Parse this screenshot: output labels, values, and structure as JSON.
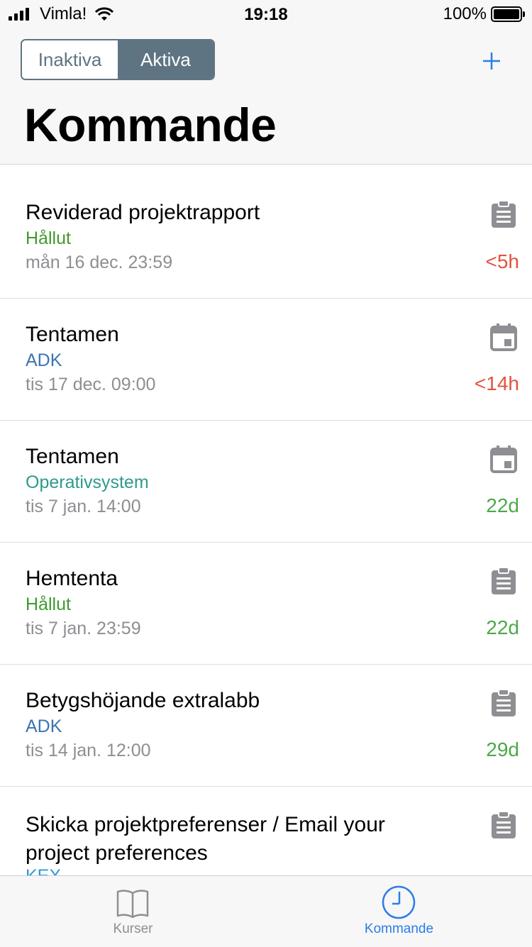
{
  "status_bar": {
    "carrier": "Vimla!",
    "time": "19:18",
    "battery": "100%"
  },
  "header": {
    "segments": [
      "Inaktiva",
      "Aktiva"
    ],
    "selected_segment": "Aktiva",
    "add_label": "+",
    "title": "Kommande"
  },
  "items": [
    {
      "title": "Reviderad projektrapport",
      "course": "Hållut",
      "course_color": "#3f9a2f",
      "date": "mån 16 dec. 23:59",
      "remaining": "<5h",
      "remaining_color": "#e0543f",
      "icon": "clipboard-icon"
    },
    {
      "title": "Tentamen",
      "course": "ADK",
      "course_color": "#3a74b0",
      "date": "tis 17 dec. 09:00",
      "remaining": "<14h",
      "remaining_color": "#e0543f",
      "icon": "calendar-icon"
    },
    {
      "title": "Tentamen",
      "course": "Operativsystem",
      "course_color": "#2f9a8a",
      "date": "tis 7 jan. 14:00",
      "remaining": "22d",
      "remaining_color": "#4fa84a",
      "icon": "calendar-icon"
    },
    {
      "title": "Hemtenta",
      "course": "Hållut",
      "course_color": "#3f9a2f",
      "date": "tis 7 jan. 23:59",
      "remaining": "22d",
      "remaining_color": "#4fa84a",
      "icon": "clipboard-icon"
    },
    {
      "title": "Betygshöjande extralabb",
      "course": "ADK",
      "course_color": "#3a74b0",
      "date": "tis 14 jan. 12:00",
      "remaining": "29d",
      "remaining_color": "#4fa84a",
      "icon": "clipboard-icon"
    },
    {
      "title": "Skicka projektpreferenser / Email your project preferences",
      "course": "KEX",
      "course_color": "#2b9ad8",
      "icon": "clipboard-icon"
    }
  ],
  "tab_bar": {
    "tabs": [
      {
        "label": "Kurser",
        "icon": "book-icon"
      },
      {
        "label": "Kommande",
        "icon": "clock-icon"
      }
    ],
    "selected": "Kommande"
  },
  "colors": {
    "accent": "#2b7de9",
    "segment": "#5f7482"
  }
}
